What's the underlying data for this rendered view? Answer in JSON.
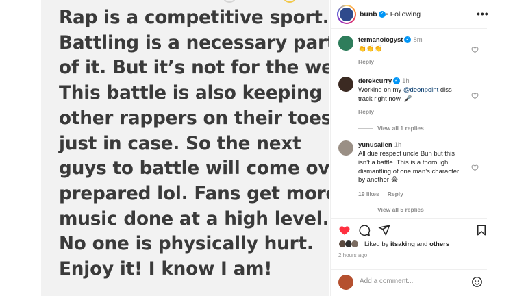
{
  "post": {
    "text_lines": [
      "Rap is a competitive sport.",
      "Battling is a necessary part",
      "of it. But it’s not for the weak.",
      "This battle is also keeping",
      "other rappers on their toes",
      "just in case. So the next",
      "guys to battle will come over",
      "prepared lol. Fans get more",
      "music done at a high level.",
      "No one is physically hurt.",
      "Enjoy it! I know I am!"
    ]
  },
  "header": {
    "username": "bunb",
    "separator": "•",
    "following_label": "Following",
    "more_icon": "more-horizontal-icon",
    "more_glyph": "•••"
  },
  "comments": [
    {
      "username": "termanologyst",
      "time": "8m",
      "text": "👏👏👏",
      "reply_label": "Reply",
      "avatar_color": "#2e7d5b"
    },
    {
      "username": "derekcurry",
      "time": "1h",
      "text_before": "Working on my ",
      "mention": "@deonpoint",
      "text_after": " diss track right now. 🎤",
      "reply_label": "Reply",
      "view_replies": "View all 1 replies",
      "avatar_color": "#3b2a22"
    },
    {
      "username": "yunusallen",
      "time": "1h",
      "text": "All due respect uncle Bun but this isn’t a battle. This is a thorough dismantling of one man’s character by another 😂",
      "likes": "19 likes",
      "reply_label": "Reply",
      "view_replies": "View all 5 replies",
      "avatar_color": "#9a8f85"
    }
  ],
  "actions": {
    "like_icon": "heart-filled-icon",
    "comment_icon": "comment-icon",
    "share_icon": "send-icon",
    "save_icon": "bookmark-icon",
    "liked_by_prefix": "Liked by ",
    "liked_by_user": "itsaking",
    "liked_by_suffix": " and ",
    "liked_by_others": "others",
    "post_time": "2 hours ago"
  },
  "add_comment": {
    "placeholder": "Add a comment...",
    "emoji_icon": "emoji-icon"
  },
  "colors": {
    "like_red": "#ff3040",
    "verified_blue": "#0095f6",
    "mention_blue": "#00376b",
    "post_background": "#f2f2f2",
    "post_text": "#3a3a3a"
  }
}
